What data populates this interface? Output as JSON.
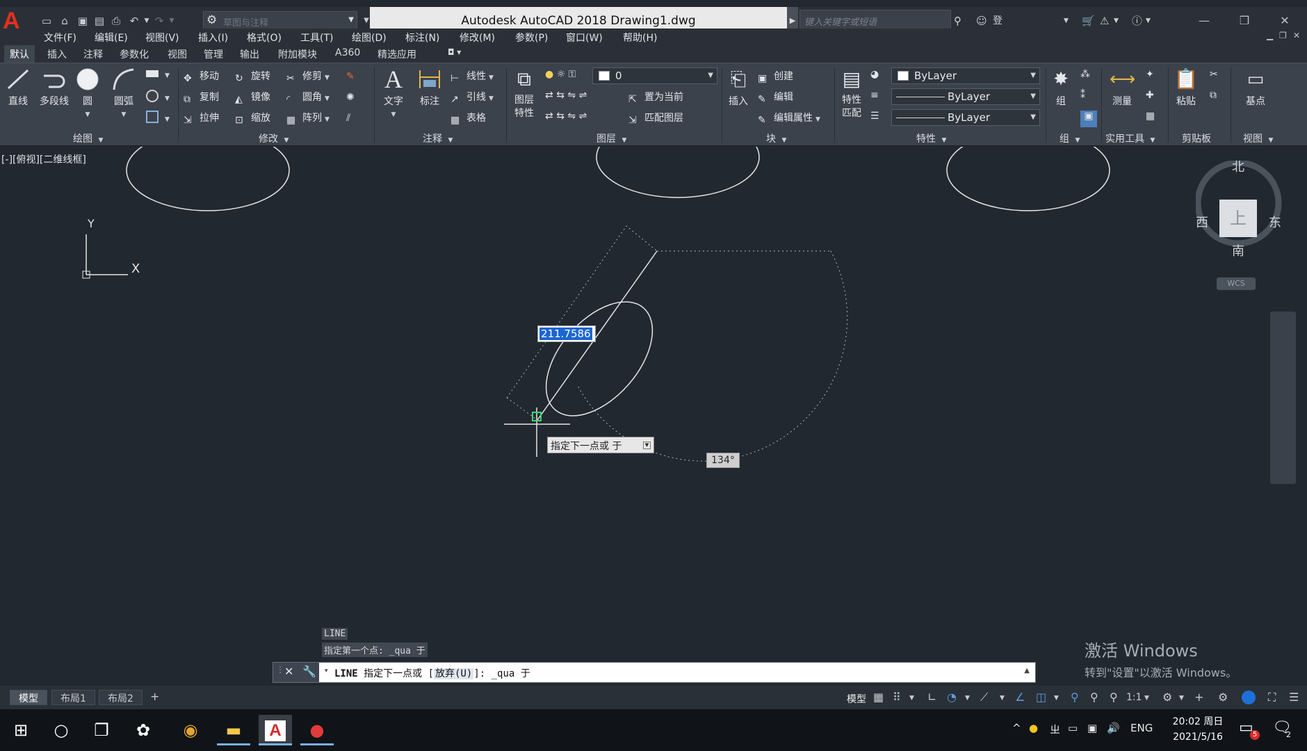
{
  "titlebar": {
    "title": "Autodesk AutoCAD 2018    Drawing1.dwg",
    "workspace_placeholder": "草图与注释",
    "search_placeholder": "键入关键字或短语",
    "login_label": "登录"
  },
  "menubar": {
    "items": [
      "文件(F)",
      "编辑(E)",
      "视图(V)",
      "插入(I)",
      "格式(O)",
      "工具(T)",
      "绘图(D)",
      "标注(N)",
      "修改(M)",
      "参数(P)",
      "窗口(W)",
      "帮助(H)"
    ]
  },
  "ribbon_tabs": [
    "默认",
    "插入",
    "注释",
    "参数化",
    "视图",
    "管理",
    "输出",
    "附加模块",
    "A360",
    "精选应用"
  ],
  "ribbon": {
    "draw": {
      "line": "直线",
      "polyline": "多段线",
      "circle": "圆",
      "arc": "圆弧",
      "title": "绘图"
    },
    "modify": {
      "move": "移动",
      "rotate": "旋转",
      "trim": "修剪",
      "copy": "复制",
      "mirror": "镜像",
      "fillet": "圆角",
      "stretch": "拉伸",
      "scale": "缩放",
      "array": "阵列",
      "title": "修改"
    },
    "annotation": {
      "text": "文字",
      "dimension": "标注",
      "linear": "线性",
      "leader": "引线",
      "table": "表格",
      "title": "注释"
    },
    "layers": {
      "layer_properties": "图层\n特性",
      "layer_properties_1": "图层",
      "layer_properties_2": "特性",
      "current_layer": "0",
      "set_current": "置为当前",
      "match_layer": "匹配图层",
      "title": "图层"
    },
    "block": {
      "insert": "插入",
      "create": "创建",
      "edit": "编辑",
      "edit_attributes": "编辑属性",
      "title": "块"
    },
    "properties": {
      "match_1": "特性",
      "match_2": "匹配",
      "color": "ByLayer",
      "linetype": "ByLayer",
      "lineweight": "ByLayer",
      "title": "特性"
    },
    "groups": {
      "group": "组",
      "title": "组"
    },
    "utilities": {
      "measure": "测量",
      "title": "实用工具"
    },
    "clipboard": {
      "paste": "粘贴",
      "title": "剪贴板"
    },
    "view": {
      "base": "基点",
      "title": "视图"
    }
  },
  "viewport": {
    "label": "[-][俯视][二维线框]",
    "ucs_y": "Y",
    "ucs_x": "X",
    "viewcube": {
      "north": "北",
      "south": "南",
      "east": "东",
      "west": "西",
      "top": "上",
      "wcs": "WCS"
    },
    "dynamic_input_value": "211.7586",
    "prompt_tip": "指定下一点或 于",
    "angle_tip": "134°",
    "history": [
      "LINE",
      "指定第一个点: _qua 于"
    ],
    "watermark_1": "激活 Windows",
    "watermark_2": "转到\"设置\"以激活 Windows。"
  },
  "commandline": {
    "cmd": "LINE",
    "text_before": "指定下一点或 [",
    "option": "放弃(U)",
    "text_after": "]: _qua 于"
  },
  "layout_tabs": [
    "模型",
    "布局1",
    "布局2"
  ],
  "statusbar": {
    "model": "模型",
    "scale": "1:1"
  },
  "taskbar": {
    "tray_lang": "ENG",
    "time": "20:02 周日",
    "date": "2021/5/16",
    "notif_count": "2",
    "mail_badge": "5"
  },
  "colors": {
    "canvas_bg": "#212830",
    "ribbon_bg": "#3b424c",
    "dyn_input_highlight": "#1c66d1",
    "logo_red": "#e0301e"
  }
}
